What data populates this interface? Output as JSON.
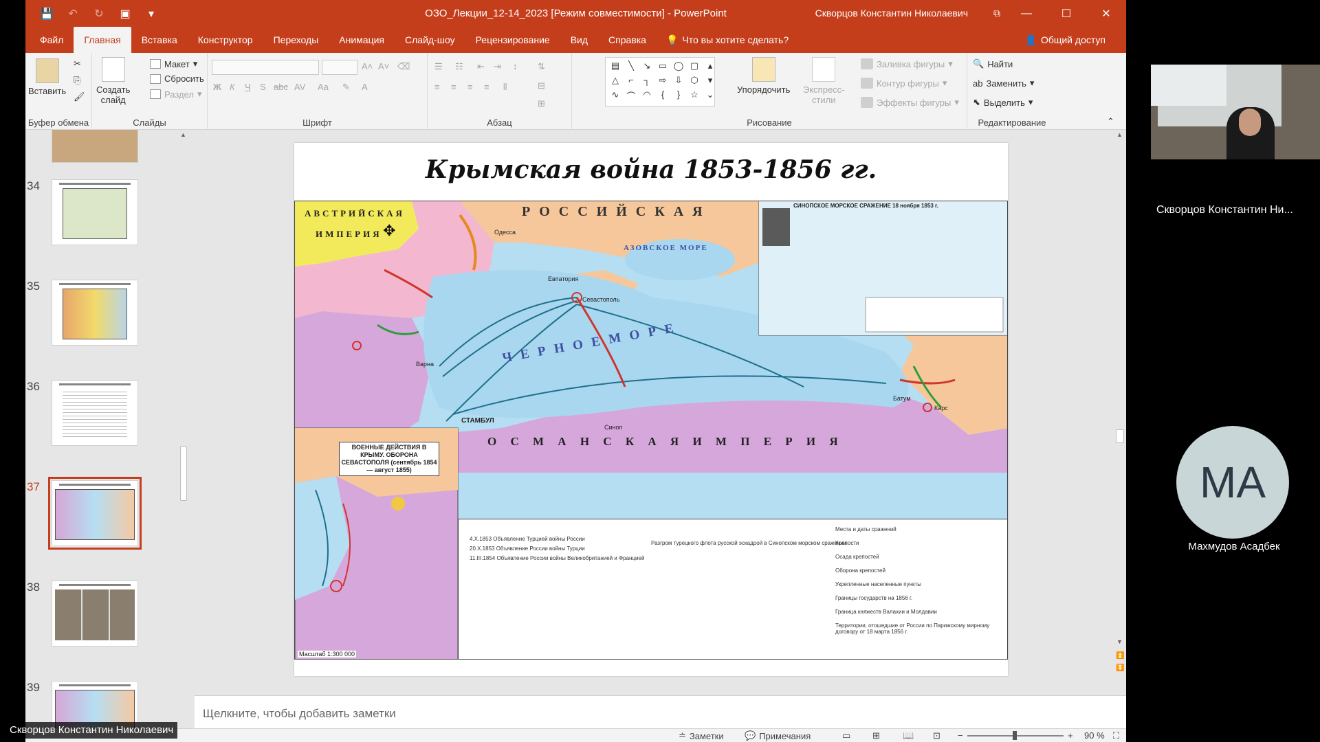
{
  "window": {
    "title": "ОЗО_Лекции_12-14_2023 [Режим совместимости]  -  PowerPoint",
    "user": "Скворцов Константин Николаевич"
  },
  "tabs": [
    "Файл",
    "Главная",
    "Вставка",
    "Конструктор",
    "Переходы",
    "Анимация",
    "Слайд-шоу",
    "Рецензирование",
    "Вид",
    "Справка"
  ],
  "active_tab": "Главная",
  "tell_me": "Что вы хотите сделать?",
  "share": "Общий доступ",
  "ribbon": {
    "clipboard": {
      "paste": "Вставить",
      "label": "Буфер обмена"
    },
    "slides": {
      "new_slide_1": "Создать",
      "new_slide_2": "слайд",
      "layout": "Макет",
      "reset": "Сбросить",
      "section": "Раздел",
      "label": "Слайды"
    },
    "font": {
      "label": "Шрифт",
      "bold": "Ж",
      "italic": "К",
      "underline": "Ч",
      "shadow": "S",
      "strike": "abc",
      "spacing": "AV",
      "case": "Aa",
      "color": "A"
    },
    "paragraph": {
      "label": "Абзац"
    },
    "drawing": {
      "arrange": "Упорядочить",
      "quick_styles_1": "Экспресс-",
      "quick_styles_2": "стили",
      "fill": "Заливка фигуры",
      "outline": "Контур фигуры",
      "effects": "Эффекты фигуры",
      "label": "Рисование"
    },
    "editing": {
      "find": "Найти",
      "replace": "Заменить",
      "select": "Выделить",
      "label": "Редактирование"
    }
  },
  "thumbnails": [
    {
      "num": "34",
      "selected": false
    },
    {
      "num": "35",
      "selected": false
    },
    {
      "num": "36",
      "selected": false
    },
    {
      "num": "37",
      "selected": true
    },
    {
      "num": "38",
      "selected": false
    },
    {
      "num": "39",
      "selected": false
    }
  ],
  "slide": {
    "title": "Крымская война 1853-1856 гг.",
    "map_labels": {
      "austria_1": "АВСТРИЙСКАЯ",
      "austria_2": "ИМПЕРИЯ",
      "russia": "Р О С С И Й С К А Я",
      "black_sea": "Ч Е Р Н О Е   М О Р Е",
      "azov": "АЗОВСКОЕ МОРЕ",
      "ottoman": "О С М А Н С К А Я   И М П Е Р И Я",
      "stambul": "СТАМБУЛ",
      "sevastopol": "Севастополь",
      "odessa": "Одесса",
      "evpatoria": "Евпатория",
      "varna": "Варна",
      "sinop": "Синоп",
      "kars": "Карс",
      "batum": "Батум",
      "inset": "ВОЕННЫЕ ДЕЙСТВИЯ В КРЫМУ. ОБОРОНА СЕВАСТОПОЛЯ (сентябрь 1854 — август 1855)",
      "synop_battle": "СИНОПСКОЕ МОРСКОЕ СРАЖЕНИЕ 18 ноября 1853 г.",
      "scale": "Масштаб 1:300 000"
    },
    "legend": [
      "4.X.1853  Объявление Турцией войны России",
      "20.X.1853  Объявление России войны Турции",
      "11.III.1854  Объявление России войны Великобританией и Францией",
      "Разгром турецкого флота русской эскадрой в Синопском морском сражении",
      "Места и даты сражений",
      "Крепости",
      "Осада крепостей",
      "Оборона крепостей",
      "Укрепленные населенные пункты",
      "Границы государств на 1856 г.",
      "Граница княжеств Валахии и Молдавии",
      "Территории, отошедшие от России по Парижскому мирному договору от 18 марта 1856 г."
    ]
  },
  "notes_placeholder": "Щелкните, чтобы добавить заметки",
  "status": {
    "notes": "Заметки",
    "comments": "Примечания",
    "zoom": "90 %"
  },
  "participants": {
    "presenter": "Скворцов Константин Ни...",
    "avatar_initials": "МА",
    "avatar_name": "Махмудов Асадбек",
    "speaker_tag": "Скворцов Константин Николаевич"
  },
  "colors": {
    "accent": "#c43e1c"
  }
}
